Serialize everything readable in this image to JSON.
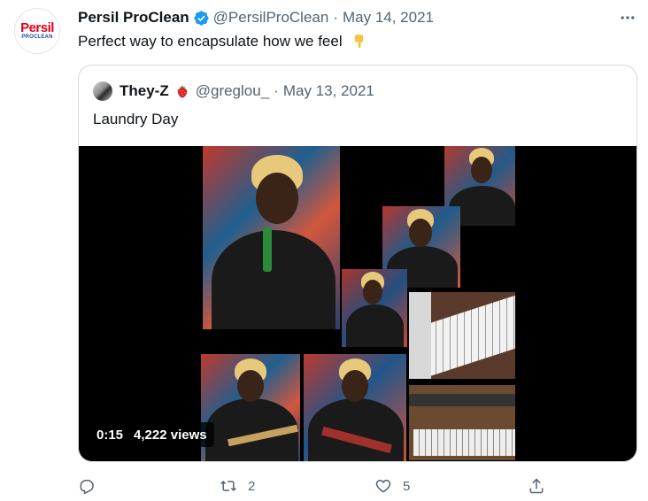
{
  "tweet": {
    "author": {
      "name": "Persil ProClean",
      "handle": "@PersilProClean",
      "avatar_brand": "Persil",
      "avatar_sub": "PROCLEAN"
    },
    "date": "May 14, 2021",
    "text": "Perfect way to encapsulate how we feel",
    "emoji": "point-down-emoji"
  },
  "quoted": {
    "author": {
      "name": "They-Z",
      "handle": "@greglou_",
      "emoji": "strawberry-emoji"
    },
    "date": "May 13, 2021",
    "text": "Laundry Day",
    "video": {
      "duration": "0:15",
      "views": "4,222 views"
    }
  },
  "actions": {
    "reply_count": "",
    "retweet_count": "2",
    "like_count": "5"
  },
  "colors": {
    "verified": "#1d9bf0",
    "muted_text": "#536471",
    "border": "#cfd9de",
    "persil_red": "#e2001a"
  }
}
